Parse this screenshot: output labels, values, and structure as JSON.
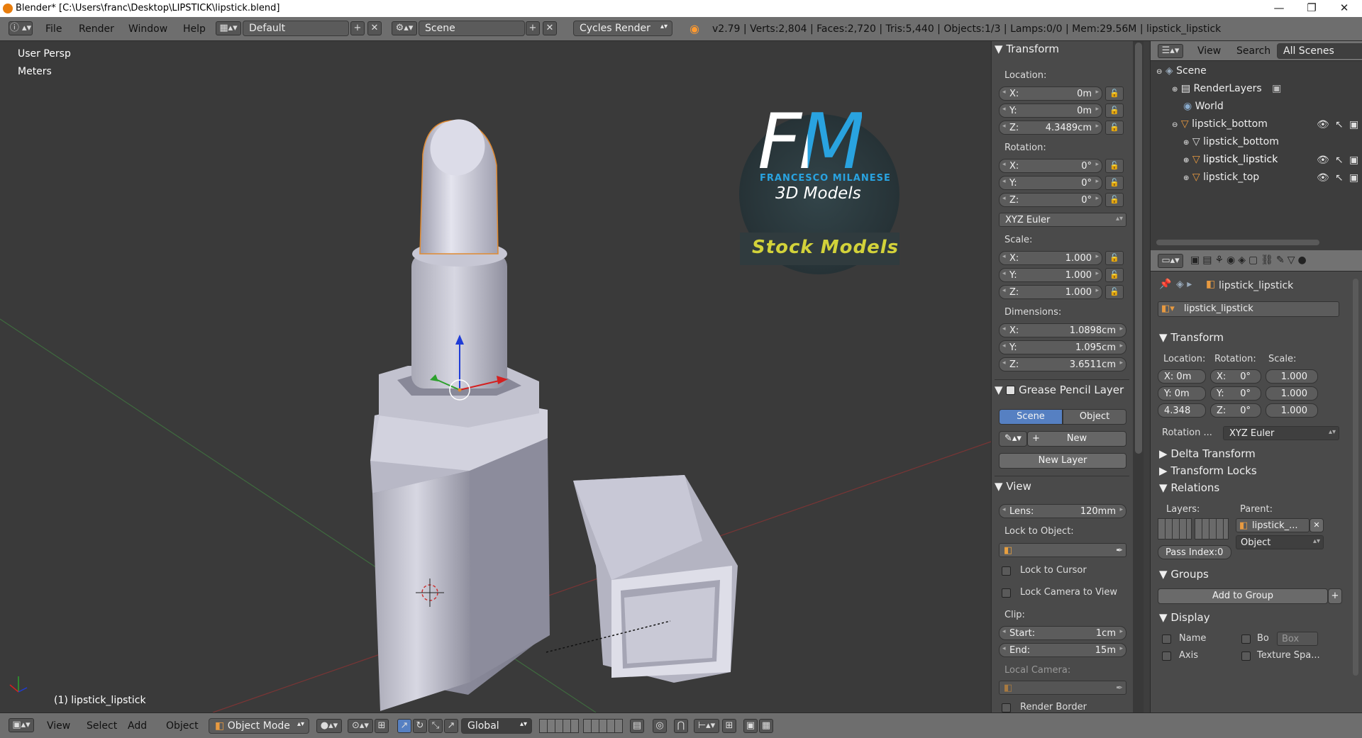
{
  "window": {
    "title": "Blender* [C:\\Users\\franc\\Desktop\\LIPSTICK\\lipstick.blend]",
    "controls": [
      "—",
      "❐",
      "✕"
    ]
  },
  "topbar": {
    "info_icon": "ⓘ",
    "menus": [
      "File",
      "Render",
      "Window",
      "Help"
    ],
    "screen_layout": "Default",
    "scene": "Scene",
    "render_engine": "Cycles Render",
    "stats": "v2.79 | Verts:2,804 | Faces:2,720 | Tris:5,440 | Objects:1/3 | Lamps:0/0 | Mem:29.56M | lipstick_lipstick"
  },
  "viewport": {
    "view_name": "User Persp",
    "units": "Meters",
    "object_label": "(1) lipstick_lipstick",
    "logo": {
      "letters": "FM",
      "name": "FRANCESCO MILANESE",
      "tagline": "3D Models",
      "banner": "Stock Models"
    }
  },
  "transform_panel": {
    "header": "Transform",
    "location_label": "Location:",
    "location": [
      {
        "k": "X:",
        "v": "0m"
      },
      {
        "k": "Y:",
        "v": "0m"
      },
      {
        "k": "Z:",
        "v": "4.3489cm"
      }
    ],
    "rotation_label": "Rotation:",
    "rotation": [
      {
        "k": "X:",
        "v": "0°"
      },
      {
        "k": "Y:",
        "v": "0°"
      },
      {
        "k": "Z:",
        "v": "0°"
      }
    ],
    "rotation_mode": "XYZ Euler",
    "scale_label": "Scale:",
    "scale": [
      {
        "k": "X:",
        "v": "1.000"
      },
      {
        "k": "Y:",
        "v": "1.000"
      },
      {
        "k": "Z:",
        "v": "1.000"
      }
    ],
    "dimensions_label": "Dimensions:",
    "dimensions": [
      {
        "k": "X:",
        "v": "1.0898cm"
      },
      {
        "k": "Y:",
        "v": "1.095cm"
      },
      {
        "k": "Z:",
        "v": "3.6511cm"
      }
    ]
  },
  "grease_panel": {
    "header": "Grease Pencil Layer",
    "tab_scene": "Scene",
    "tab_object": "Object",
    "new_label": "New",
    "new_layer": "New Layer"
  },
  "view_panel": {
    "header": "View",
    "lens_label": "Lens:",
    "lens_value": "120mm",
    "lock_to_object": "Lock to Object:",
    "lock_cursor": "Lock to Cursor",
    "lock_camera": "Lock Camera to View",
    "clip_label": "Clip:",
    "clip_start_k": "Start:",
    "clip_start_v": "1cm",
    "clip_end_k": "End:",
    "clip_end_v": "15m",
    "local_camera": "Local Camera:",
    "render_border": "Render Border"
  },
  "outliner": {
    "view_menu": "View",
    "search_menu": "Search",
    "filter": "All Scenes",
    "items": [
      {
        "label": "Scene"
      },
      {
        "label": "RenderLayers"
      },
      {
        "label": "World"
      },
      {
        "label": "lipstick_bottom"
      },
      {
        "label": "lipstick_bottom"
      },
      {
        "label": "lipstick_lipstick"
      },
      {
        "label": "lipstick_top"
      }
    ]
  },
  "properties": {
    "breadcrumb": "lipstick_lipstick",
    "object_name": "lipstick_lipstick",
    "transform_header": "Transform",
    "location_label": "Location:",
    "rotation_label": "Rotation:",
    "scale_label": "Scale:",
    "loc": [
      "X: 0m",
      "Y: 0m",
      "4.348"
    ],
    "rot": [
      "X:",
      "Y:",
      "Z:"
    ],
    "rot_v": [
      "0°",
      "0°",
      "0°"
    ],
    "scl": [
      "1.000",
      "1.000",
      "1.000"
    ],
    "rotation_mode_label": "Rotation ...",
    "rotation_mode": "XYZ Euler",
    "delta_transform": "Delta Transform",
    "transform_locks": "Transform Locks",
    "relations": "Relations",
    "layers_label": "Layers:",
    "parent_label": "Parent:",
    "parent_value": "lipstick_...",
    "parent_type": "Object",
    "pass_index": "Pass Index:0",
    "groups": "Groups",
    "add_to_group": "Add to Group",
    "display": "Display",
    "name_label": "Name",
    "bo_label": "Bo",
    "box_label": "Box",
    "axis_label": "Axis",
    "texture_space": "Texture Spa..."
  },
  "bottombar": {
    "menus": [
      "View",
      "Select",
      "Add",
      "Object"
    ],
    "mode": "Object Mode",
    "orientation": "Global"
  }
}
